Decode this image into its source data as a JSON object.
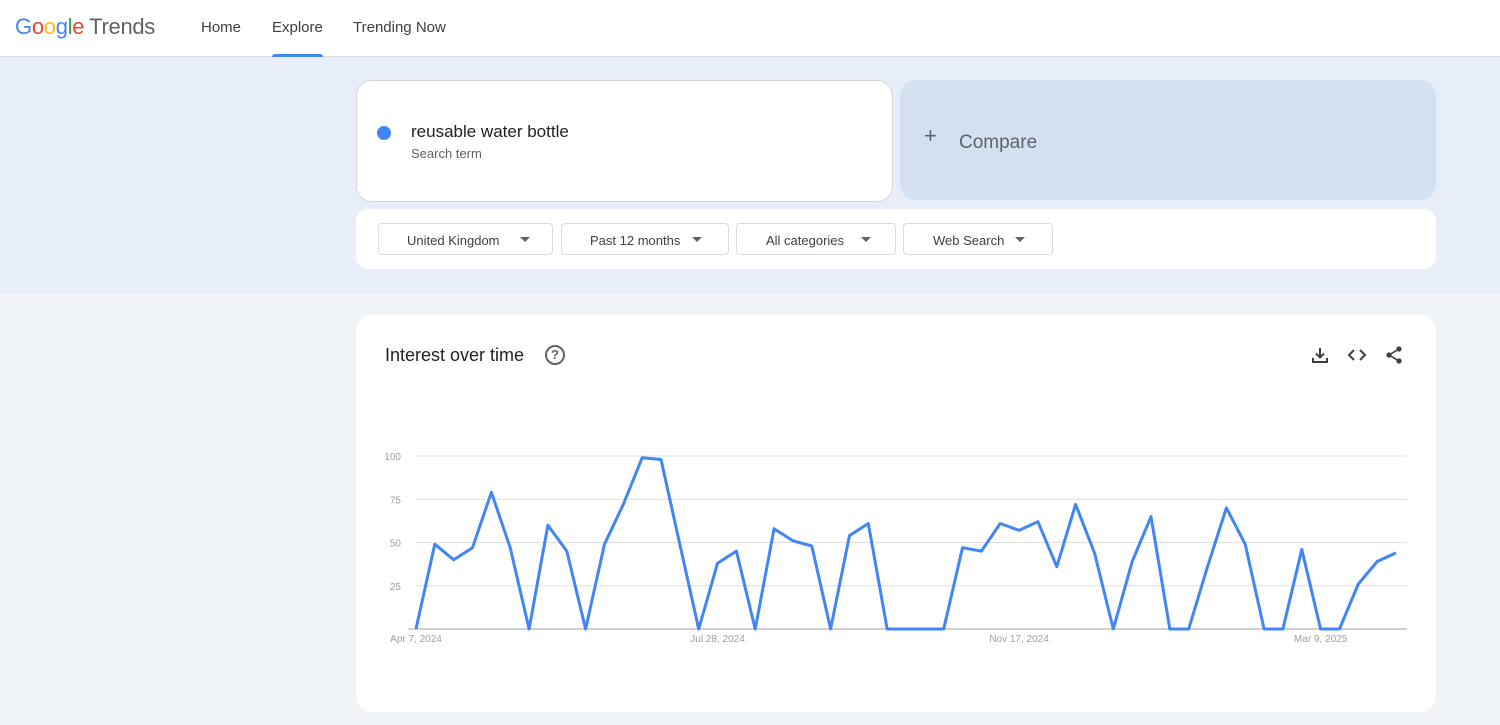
{
  "logo": {
    "brand": [
      "G",
      "o",
      "o",
      "g",
      "l",
      "e"
    ],
    "product": "Trends"
  },
  "nav": {
    "items": [
      "Home",
      "Explore",
      "Trending Now"
    ],
    "active": "Explore"
  },
  "search_term": {
    "term": "reusable water bottle",
    "label": "Search term",
    "color": "#4285f4"
  },
  "compare": {
    "label": "Compare",
    "icon": "plus-icon"
  },
  "filters": {
    "region": "United Kingdom",
    "time_range": "Past 12 months",
    "category": "All categories",
    "search_type": "Web Search"
  },
  "chart_card": {
    "title": "Interest over time",
    "icons": [
      "help-icon",
      "download-icon",
      "embed-icon",
      "share-icon"
    ]
  },
  "chart_data": {
    "type": "line",
    "x_tick_labels": [
      "Apr 7, 2024",
      "Jul 28, 2024",
      "Nov 17, 2024",
      "Mar 9, 2025"
    ],
    "x_tick_indices": [
      0,
      16,
      32,
      48
    ],
    "y_ticks": [
      25,
      50,
      75,
      100
    ],
    "ylim": [
      0,
      100
    ],
    "grid": true,
    "line_color": "#4285f4",
    "series": [
      {
        "values": [
          0,
          49,
          40,
          47,
          79,
          47,
          0,
          60,
          45,
          0,
          49,
          72,
          99,
          98,
          49,
          0,
          38,
          45,
          0,
          58,
          51,
          48,
          0,
          54,
          61,
          0,
          0,
          0,
          0,
          47,
          45,
          61,
          57,
          62,
          36,
          72,
          44,
          0,
          39,
          65,
          0,
          0,
          36,
          70,
          49,
          0,
          0,
          46,
          0,
          0,
          26,
          39,
          44
        ]
      }
    ]
  }
}
